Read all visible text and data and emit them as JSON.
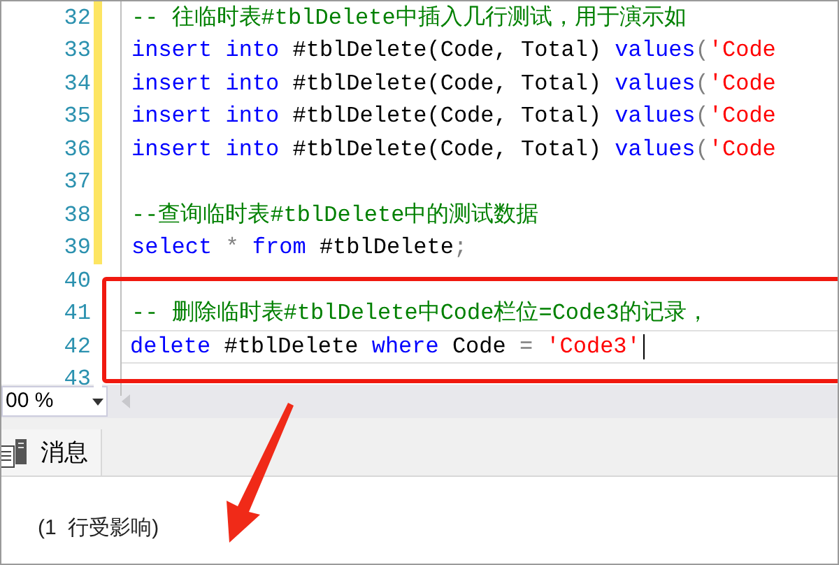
{
  "editor": {
    "lines": [
      {
        "number": "32",
        "modified": true,
        "current": false,
        "tokens": [
          {
            "kind": "comment",
            "text": "-- 往临时表#tblDelete中插入几行测试，用于演示如"
          }
        ]
      },
      {
        "number": "33",
        "modified": true,
        "current": false,
        "tokens": [
          {
            "kind": "keyword",
            "text": "insert "
          },
          {
            "kind": "keyword",
            "text": "into "
          },
          {
            "kind": "plain",
            "text": "#tblDelete(Code, Total) "
          },
          {
            "kind": "keyword",
            "text": "values"
          },
          {
            "kind": "operator",
            "text": "("
          },
          {
            "kind": "string",
            "text": "'Code"
          }
        ]
      },
      {
        "number": "34",
        "modified": true,
        "current": false,
        "tokens": [
          {
            "kind": "keyword",
            "text": "insert "
          },
          {
            "kind": "keyword",
            "text": "into "
          },
          {
            "kind": "plain",
            "text": "#tblDelete(Code, Total) "
          },
          {
            "kind": "keyword",
            "text": "values"
          },
          {
            "kind": "operator",
            "text": "("
          },
          {
            "kind": "string",
            "text": "'Code"
          }
        ]
      },
      {
        "number": "35",
        "modified": true,
        "current": false,
        "tokens": [
          {
            "kind": "keyword",
            "text": "insert "
          },
          {
            "kind": "keyword",
            "text": "into "
          },
          {
            "kind": "plain",
            "text": "#tblDelete(Code, Total) "
          },
          {
            "kind": "keyword",
            "text": "values"
          },
          {
            "kind": "operator",
            "text": "("
          },
          {
            "kind": "string",
            "text": "'Code"
          }
        ]
      },
      {
        "number": "36",
        "modified": true,
        "current": false,
        "tokens": [
          {
            "kind": "keyword",
            "text": "insert "
          },
          {
            "kind": "keyword",
            "text": "into "
          },
          {
            "kind": "plain",
            "text": "#tblDelete(Code, Total) "
          },
          {
            "kind": "keyword",
            "text": "values"
          },
          {
            "kind": "operator",
            "text": "("
          },
          {
            "kind": "string",
            "text": "'Code"
          }
        ]
      },
      {
        "number": "37",
        "modified": true,
        "current": false
      },
      {
        "number": "38",
        "modified": true,
        "current": false,
        "tokens": [
          {
            "kind": "comment",
            "text": "--查询临时表#tblDelete中的测试数据"
          }
        ]
      },
      {
        "number": "39",
        "modified": true,
        "current": false,
        "tokens": [
          {
            "kind": "keyword",
            "text": "select "
          },
          {
            "kind": "operator",
            "text": "* "
          },
          {
            "kind": "keyword",
            "text": "from "
          },
          {
            "kind": "plain",
            "text": "#tblDelete"
          },
          {
            "kind": "operator",
            "text": ";"
          }
        ]
      },
      {
        "number": "40",
        "modified": false,
        "current": false
      },
      {
        "number": "41",
        "modified": false,
        "current": false,
        "tokens": [
          {
            "kind": "comment",
            "text": "-- 删除临时表#tblDelete中Code栏位=Code3的记录，"
          }
        ]
      },
      {
        "number": "42",
        "modified": false,
        "current": true,
        "tokens": [
          {
            "kind": "keyword",
            "text": "delete "
          },
          {
            "kind": "plain",
            "text": "#tblDelete "
          },
          {
            "kind": "keyword",
            "text": "where "
          },
          {
            "kind": "plain",
            "text": "Code "
          },
          {
            "kind": "operator",
            "text": "= "
          },
          {
            "kind": "string",
            "text": "'Code3'"
          }
        ]
      },
      {
        "number": "43",
        "modified": false,
        "current": false
      }
    ]
  },
  "zoom": {
    "value": "00 %"
  },
  "results": {
    "tabs": [
      {
        "label": "消息",
        "selected": true
      }
    ],
    "message": "(1  行受影响)"
  }
}
